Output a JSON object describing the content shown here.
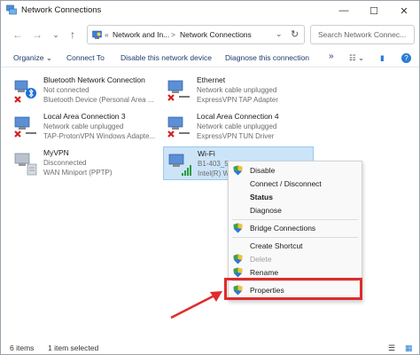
{
  "window": {
    "title": "Network Connections",
    "minimize": "—",
    "maximize": "☐",
    "close": "✕"
  },
  "nav": {
    "back": "←",
    "forward": "→",
    "recent": "⌄",
    "up": "↑",
    "breadcrumb_sep1": "«",
    "crumb1": "Network and In...",
    "breadcrumb_sep2": ">",
    "crumb2": "Network Connections",
    "dropdown": "⌄",
    "refresh": "↻",
    "search_placeholder": "Search Network Connec..."
  },
  "commands": {
    "organize": "Organize ⌄",
    "connect_to": "Connect To",
    "disable": "Disable this network device",
    "diagnose": "Diagnose this connection",
    "more": "»",
    "view": "☷ ⌄",
    "pane": "▮",
    "help": "?"
  },
  "connections": [
    {
      "name": "Bluetooth Network Connection",
      "status": "Not connected",
      "device": "Bluetooth Device (Personal Area ..."
    },
    {
      "name": "Ethernet",
      "status": "Network cable unplugged",
      "device": "ExpressVPN TAP Adapter"
    },
    {
      "name": "Local Area Connection 3",
      "status": "Network cable unplugged",
      "device": "TAP-ProtonVPN Windows Adapte..."
    },
    {
      "name": "Local Area Connection 4",
      "status": "Network cable unplugged",
      "device": "ExpressVPN TUN Driver"
    },
    {
      "name": "MyVPN",
      "status": "Disconnected",
      "device": "WAN Miniport (PPTP)"
    },
    {
      "name": "Wi-Fi",
      "status": "B1-403_5G",
      "device": "Intel(R) W..."
    }
  ],
  "context_menu": {
    "disable": "Disable",
    "connect_disconnect": "Connect / Disconnect",
    "status": "Status",
    "diagnose": "Diagnose",
    "bridge": "Bridge Connections",
    "create_shortcut": "Create Shortcut",
    "delete": "Delete",
    "rename": "Rename",
    "properties": "Properties"
  },
  "statusbar": {
    "items": "6 items",
    "selected": "1 item selected"
  },
  "colors": {
    "accent": "#0067c0",
    "highlight": "#e02b2b",
    "selection": "#cce4f7"
  }
}
